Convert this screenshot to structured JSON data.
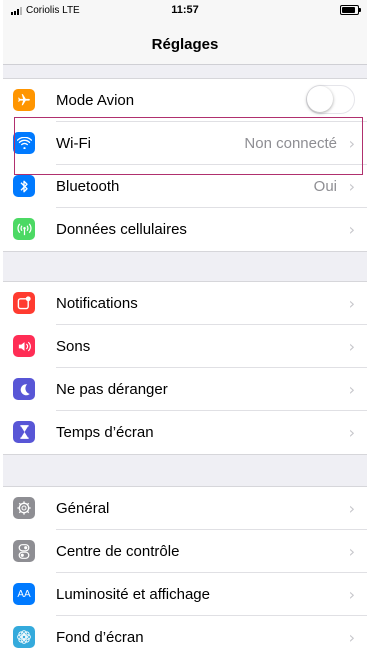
{
  "status_bar": {
    "carrier": "Coriolis",
    "network": "LTE",
    "time": "11:57"
  },
  "nav": {
    "title": "Réglages"
  },
  "groups": [
    {
      "items": [
        {
          "id": "mode-avion",
          "label": "Mode Avion",
          "icon": "airplane-icon",
          "color": "#ff9500",
          "toggle": false
        },
        {
          "id": "wifi",
          "label": "Wi-Fi",
          "icon": "wifi-icon",
          "color": "#007aff",
          "value": "Non connecté",
          "highlighted": true
        },
        {
          "id": "bluetooth",
          "label": "Bluetooth",
          "icon": "bluetooth-icon",
          "color": "#007aff",
          "value": "Oui"
        },
        {
          "id": "donnees-cellulaires",
          "label": "Données cellulaires",
          "icon": "cellular-icon",
          "color": "#4cd964"
        }
      ]
    },
    {
      "items": [
        {
          "id": "notifications",
          "label": "Notifications",
          "icon": "notifications-icon",
          "color": "#ff3b30"
        },
        {
          "id": "sons",
          "label": "Sons",
          "icon": "speaker-icon",
          "color": "#ff2d55"
        },
        {
          "id": "ne-pas-deranger",
          "label": "Ne pas déranger",
          "icon": "moon-icon",
          "color": "#5856d6"
        },
        {
          "id": "temps-ecran",
          "label": "Temps d’écran",
          "icon": "hourglass-icon",
          "color": "#5856d6"
        }
      ]
    },
    {
      "items": [
        {
          "id": "general",
          "label": "Général",
          "icon": "gear-icon",
          "color": "#8e8e93"
        },
        {
          "id": "centre-controle",
          "label": "Centre de contrôle",
          "icon": "switches-icon",
          "color": "#8e8e93"
        },
        {
          "id": "luminosite",
          "label": "Luminosité et affichage",
          "icon": "text-size-icon",
          "color": "#007aff",
          "icon_text": "AA"
        },
        {
          "id": "fond-ecran",
          "label": "Fond d’écran",
          "icon": "flower-icon",
          "color": "#34aadc"
        }
      ]
    }
  ]
}
